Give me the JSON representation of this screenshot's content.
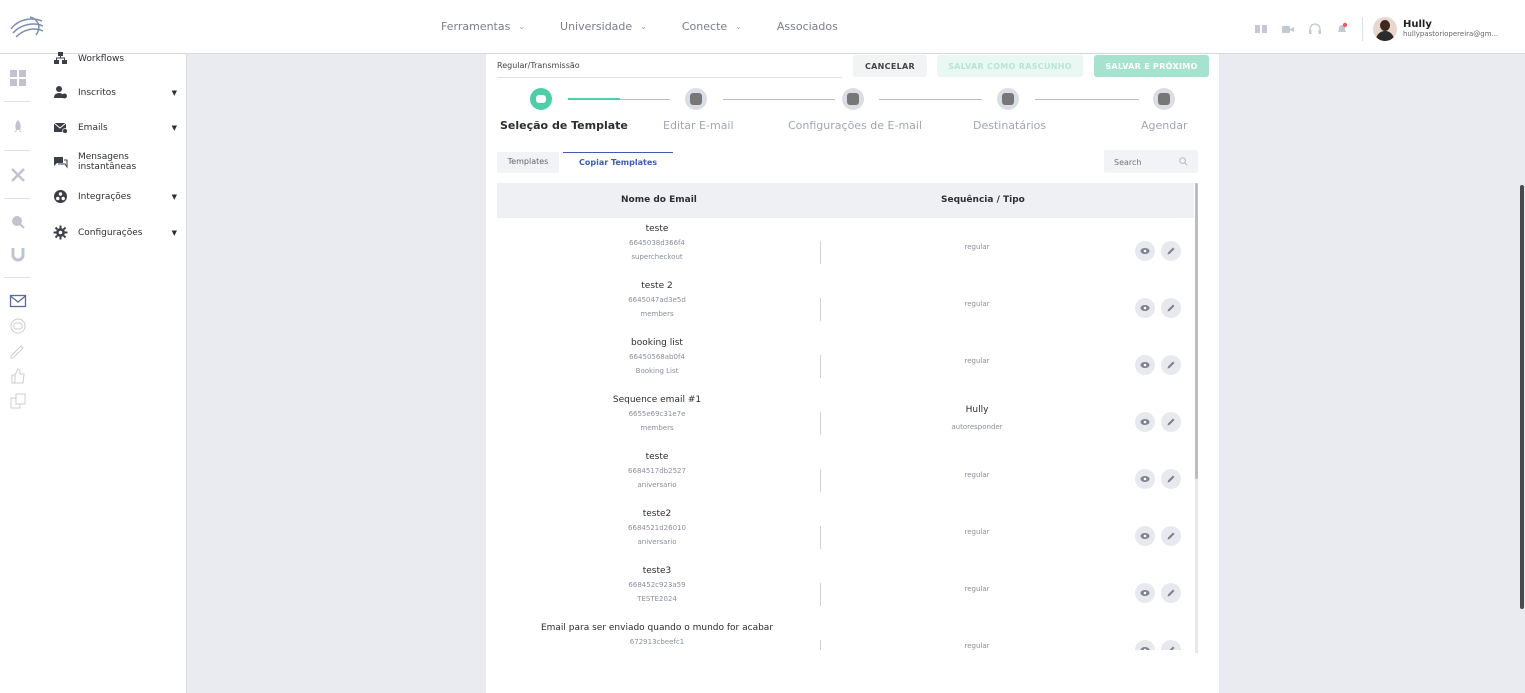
{
  "topnav": {
    "items": [
      {
        "label": "Ferramentas",
        "chevron": "⌄"
      },
      {
        "label": "Universidade",
        "chevron": "⌄"
      },
      {
        "label": "Conecte",
        "chevron": "⌄"
      },
      {
        "label": "Associados",
        "chevron": ""
      }
    ]
  },
  "user": {
    "name": "Hully",
    "email": "hullypastoriopereira@gm..."
  },
  "sidebar": {
    "items": [
      {
        "label": "Workflows",
        "icon": "workflow-icon"
      },
      {
        "label": "Inscritos",
        "icon": "subscribers-icon"
      },
      {
        "label": "Emails",
        "icon": "emails-icon"
      },
      {
        "label": "Mensagens instantâneas",
        "line1": "Mensagens",
        "line2": "instantâneas",
        "icon": "chat-icon"
      },
      {
        "label": "Integrações",
        "icon": "integrations-icon"
      },
      {
        "label": "Configurações",
        "icon": "settings-gear-icon"
      }
    ],
    "caret": "▼"
  },
  "composer": {
    "subject": "Regular/Transmissão",
    "cancel_label": "CANCELAR",
    "draft_label": "SALVAR COMO RASCUNHO",
    "next_label": "SALVAR E PRÓXIMO"
  },
  "steps": [
    {
      "label": "Seleção de Template",
      "active": true
    },
    {
      "label": "Editar E-mail",
      "active": false
    },
    {
      "label": "Configurações de E-mail",
      "active": false
    },
    {
      "label": "Destinatários",
      "active": false
    },
    {
      "label": "Agendar",
      "active": false
    }
  ],
  "tabs": [
    {
      "label": "Templates",
      "active": false
    },
    {
      "label": "Copiar Templates",
      "active": true
    }
  ],
  "search": {
    "placeholder": "Search"
  },
  "table": {
    "headers": {
      "name": "Nome do Email",
      "seq": "Sequência / Tipo"
    },
    "rows": [
      {
        "name": "teste",
        "id": "6645038d366f4",
        "desc": "supercheckout",
        "seq": "",
        "type": "regular"
      },
      {
        "name": "teste 2",
        "id": "6645047ad3e5d",
        "desc": "members",
        "seq": "",
        "type": "regular"
      },
      {
        "name": "booking list",
        "id": "66450568ab0f4",
        "desc": "Booking List",
        "seq": "",
        "type": "regular"
      },
      {
        "name": "Sequence email #1",
        "id": "6655e69c31e7e",
        "desc": "members",
        "seq": "Hully",
        "type": "autoresponder"
      },
      {
        "name": "teste",
        "id": "6684517db2527",
        "desc": "aniversario",
        "seq": "",
        "type": "regular"
      },
      {
        "name": "teste2",
        "id": "6684521d26010",
        "desc": "aniversario",
        "seq": "",
        "type": "regular"
      },
      {
        "name": "teste3",
        "id": "668452c923a59",
        "desc": "TESTE2024",
        "seq": "",
        "type": "regular"
      },
      {
        "name": "Email para ser enviado quando o mundo for acabar",
        "id": "672913cbeefc1",
        "desc": "",
        "seq": "",
        "type": "regular"
      }
    ]
  },
  "colors": {
    "accent": "#4ccfa7",
    "link": "#3b5bb5",
    "background": "#e9ebf1"
  }
}
